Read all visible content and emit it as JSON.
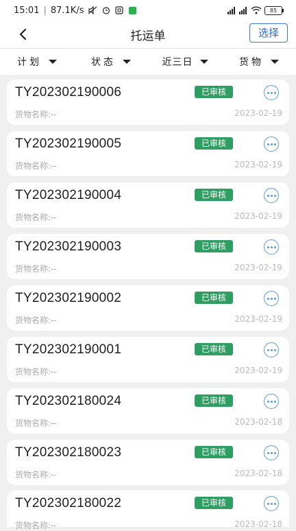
{
  "status_bar": {
    "time": "15:01",
    "speed": "87.1K/s",
    "battery": "85"
  },
  "header": {
    "title": "托运单",
    "select_label": "选择"
  },
  "filters": [
    {
      "label": "计划"
    },
    {
      "label": "状态"
    },
    {
      "label": "近三日"
    },
    {
      "label": "货物"
    }
  ],
  "orders": [
    {
      "no": "TY202302190006",
      "status": "已审核",
      "goods": "货物名称:--",
      "date": "2023-02-19"
    },
    {
      "no": "TY202302190005",
      "status": "已审核",
      "goods": "货物名称:--",
      "date": "2023-02-19"
    },
    {
      "no": "TY202302190004",
      "status": "已审核",
      "goods": "货物名称:--",
      "date": "2023-02-19"
    },
    {
      "no": "TY202302190003",
      "status": "已审核",
      "goods": "货物名称:--",
      "date": "2023-02-19"
    },
    {
      "no": "TY202302190002",
      "status": "已审核",
      "goods": "货物名称:--",
      "date": "2023-02-19"
    },
    {
      "no": "TY202302190001",
      "status": "已审核",
      "goods": "货物名称:--",
      "date": "2023-02-19"
    },
    {
      "no": "TY202302180024",
      "status": "已审核",
      "goods": "货物名称:--",
      "date": "2023-02-18"
    },
    {
      "no": "TY202302180023",
      "status": "已审核",
      "goods": "货物名称:--",
      "date": "2023-02-18"
    },
    {
      "no": "TY202302180022",
      "status": "已审核",
      "goods": "货物名称:--",
      "date": "2023-02-18"
    }
  ],
  "colors": {
    "accent": "#2d6bd0",
    "status_green": "#2e9e62",
    "more_blue": "#5a9ad8",
    "background": "#f0f0f0"
  },
  "icons": [
    "back-arrow-icon",
    "caret-down-icon",
    "more-icon",
    "wifi-icon",
    "signal-icon",
    "battery-icon"
  ]
}
